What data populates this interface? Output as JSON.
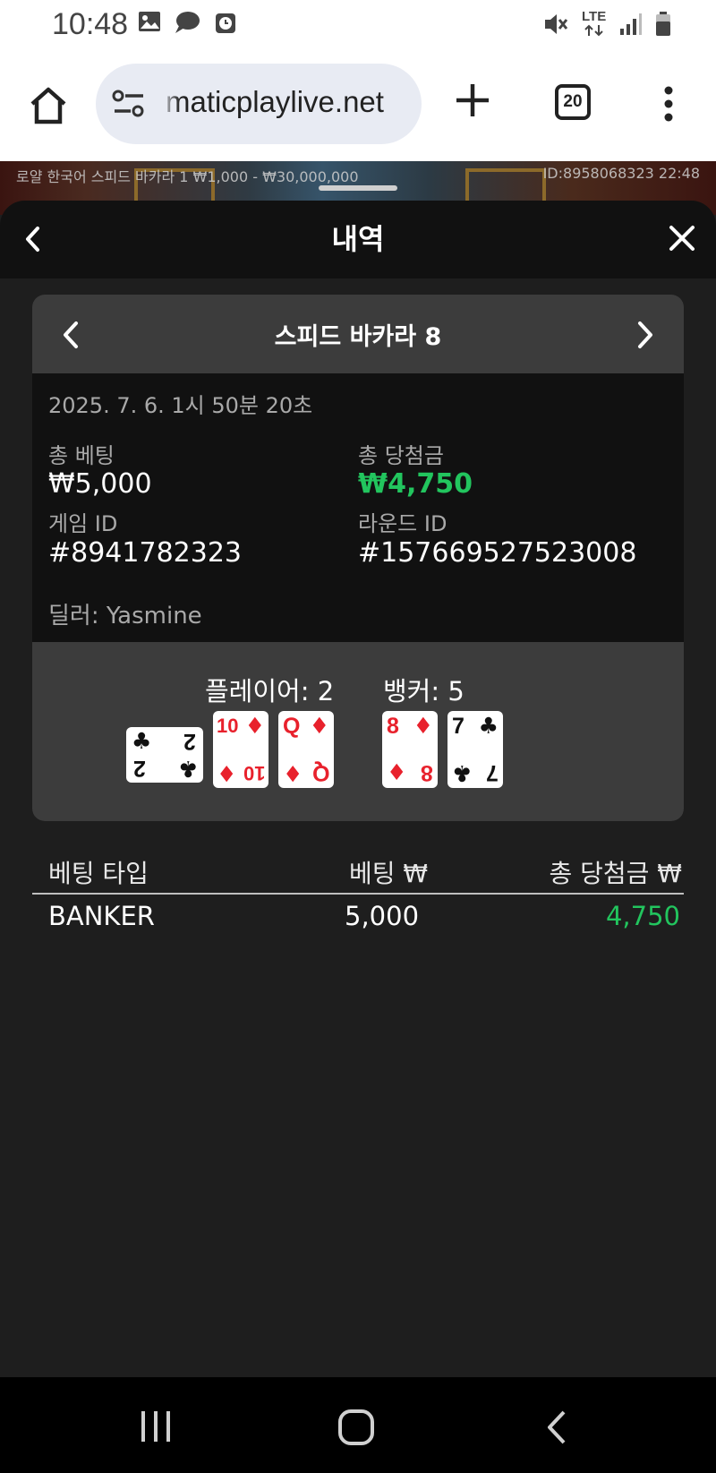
{
  "status_bar": {
    "time": "10:48",
    "network_label": "LTE",
    "icons": [
      "image-icon",
      "chat-icon",
      "clock-icon",
      "mute-icon",
      "signal-icon",
      "battery-icon"
    ]
  },
  "browser": {
    "url": "maticplaylive.net",
    "tabs_count": "20"
  },
  "game_strip": {
    "left_text": "로얄 한국어 스피드 바카라 1  ₩1,000 - ₩30,000,000",
    "right_text": "ID:8958068323  22:48"
  },
  "panel": {
    "title": "내역"
  },
  "round": {
    "game_name": "스피드 바카라 8",
    "date": "2025. 7. 6. 1시 50분 20초",
    "total_bet_label": "총 베팅",
    "total_bet_value": "₩5,000",
    "total_win_label": "총 당첨금",
    "total_win_value": "₩4,750",
    "game_id_label": "게임 ID",
    "game_id_value": "#8941782323",
    "round_id_label": "라운드 ID",
    "round_id_value": "#157669527523008",
    "dealer": "딜러: Yasmine",
    "player_score": "플레이어: 2",
    "banker_score": "뱅커: 5",
    "player_cards": [
      {
        "rank": "2",
        "suit": "♣",
        "color": "black",
        "orientation": "sideways"
      },
      {
        "rank": "10",
        "suit": "♦",
        "color": "red",
        "orientation": "upright"
      },
      {
        "rank": "Q",
        "suit": "♦",
        "color": "red",
        "orientation": "upright"
      }
    ],
    "banker_cards": [
      {
        "rank": "8",
        "suit": "♦",
        "color": "red",
        "orientation": "upright"
      },
      {
        "rank": "7",
        "suit": "♣",
        "color": "black",
        "orientation": "upright"
      }
    ]
  },
  "bets": {
    "headers": [
      "베팅 타입",
      "베팅 ₩",
      "총 당첨금 ₩"
    ],
    "rows": [
      {
        "type": "BANKER",
        "bet": "5,000",
        "win": "4,750"
      }
    ]
  },
  "colors": {
    "win_green": "#22c55e",
    "card_red": "#e8212c",
    "panel_bg": "#1e1e1e",
    "card_head_bg": "#3c3c3c"
  }
}
